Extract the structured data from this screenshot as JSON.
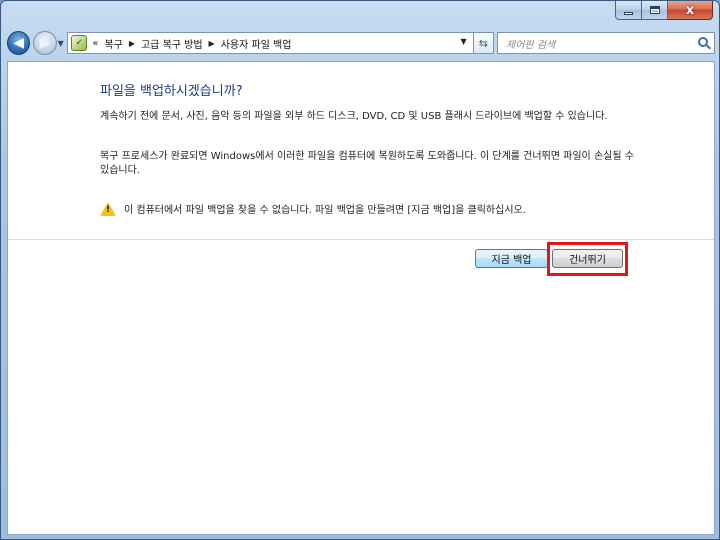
{
  "window": {
    "caption_close_glyph": "x"
  },
  "nav": {
    "back_icon": "arrow-left-icon",
    "forward_icon": "arrow-right-icon",
    "breadcrumb_prefix": "«",
    "breadcrumbs": [
      "복구",
      "고급 복구 방법",
      "사용자 파일 백업"
    ],
    "search_placeholder": "제어판 검색"
  },
  "content": {
    "title": "파일을 백업하시겠습니까?",
    "paragraph1": "계속하기 전에 문서, 사진, 음악 등의 파일을 외부 하드 디스크, DVD, CD 및 USB 플래시 드라이브에 백업할 수 있습니다.",
    "paragraph2": "복구 프로세스가 완료되면 Windows에서 이러한 파일을 컴퓨터에 복원하도록 도와줍니다. 이 단계를 건너뛰면 파일이 손실될 수 있습니다.",
    "warning_text": "이 컴퓨터에서 파일 백업을 찾을 수 없습니다. 파일 백업을 만들려면 [지금 백업]을 클릭하십시오.",
    "backup_button": "지금 백업",
    "skip_button": "건너뛰기"
  },
  "colors": {
    "title": "#1e3c88",
    "highlight": "#e01818",
    "warning": "#f0c419"
  }
}
